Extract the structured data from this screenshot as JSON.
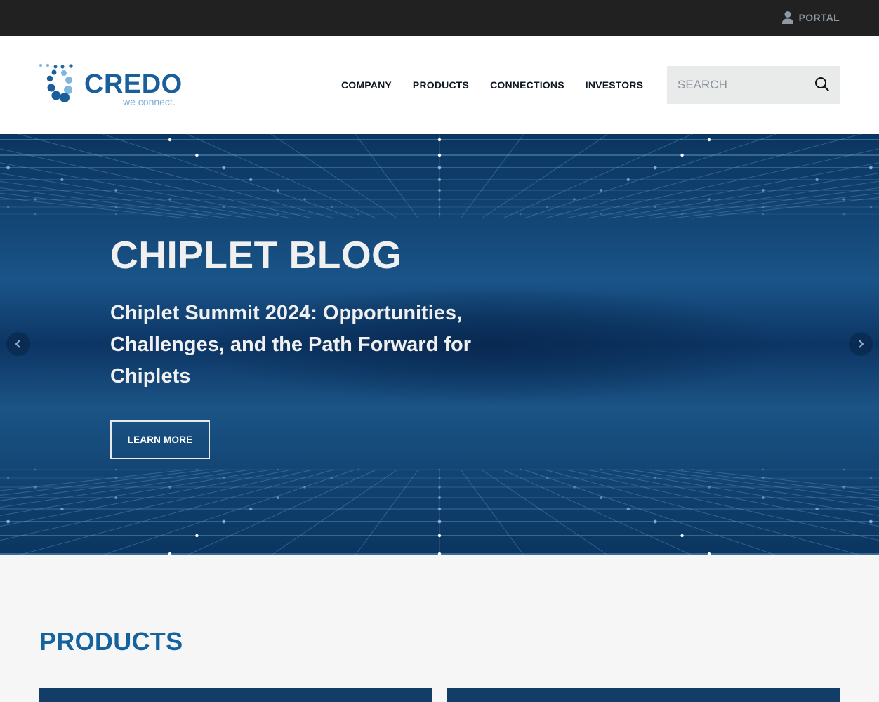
{
  "topbar": {
    "portal_label": "PORTAL",
    "portal_icon": "user-icon"
  },
  "header": {
    "logo": {
      "name": "CREDO",
      "tagline": "we connect."
    },
    "nav": [
      {
        "label": "COMPANY"
      },
      {
        "label": "PRODUCTS"
      },
      {
        "label": "CONNECTIONS"
      },
      {
        "label": "INVESTORS"
      }
    ],
    "search": {
      "placeholder": "SEARCH",
      "value": "",
      "icon": "search-icon"
    }
  },
  "hero": {
    "title": "CHIPLET BLOG",
    "subtitle": "Chiplet Summit 2024: Opportunities, Challenges, and the Path Forward for Chiplets",
    "cta_label": "LEARN MORE",
    "prev_icon": "chevron-left-icon",
    "next_icon": "chevron-right-icon"
  },
  "products": {
    "title": "PRODUCTS"
  },
  "colors": {
    "topbar": "#212121",
    "brand_blue": "#14639f",
    "hero_blue": "#0c3564",
    "search_bg": "#e9eaea",
    "light_bg": "#f6f6f6"
  }
}
